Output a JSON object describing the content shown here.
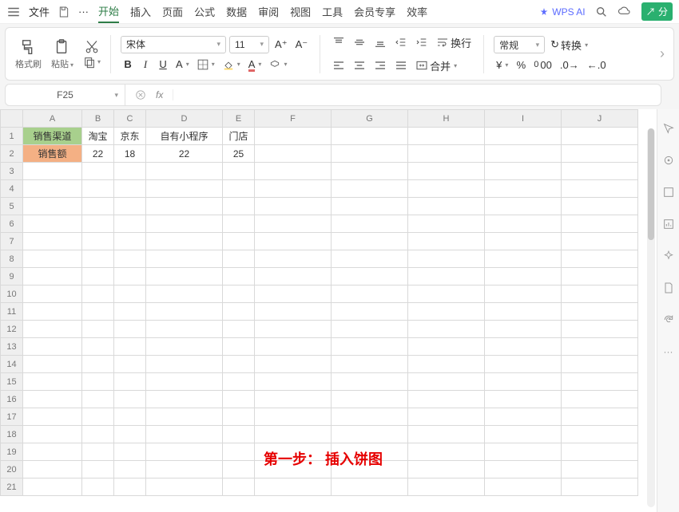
{
  "menubar": {
    "file": "文件",
    "tabs": [
      "开始",
      "插入",
      "页面",
      "公式",
      "数据",
      "审阅",
      "视图",
      "工具",
      "会员专享",
      "效率"
    ],
    "active_tab": 0,
    "ai_label": "WPS AI",
    "share": "分"
  },
  "ribbon": {
    "format_painter": "格式刷",
    "paste": "粘贴",
    "font_name": "宋体",
    "font_size": "11",
    "increase_font": "A⁺",
    "decrease_font": "A⁻",
    "bold": "B",
    "italic": "I",
    "underline": "U",
    "wrap": "换行",
    "merge": "合并",
    "number_format": "常规",
    "convert": "转换",
    "currency": "¥"
  },
  "namebox": "F25",
  "columns": [
    "A",
    "B",
    "C",
    "D",
    "E",
    "F",
    "G",
    "H",
    "I",
    "J"
  ],
  "selected_col": "F",
  "rows": 21,
  "table": {
    "r1": {
      "A": "销售渠道",
      "B": "淘宝",
      "C": "京东",
      "D": "自有小程序",
      "E": "门店"
    },
    "r2": {
      "A": "销售额",
      "B": "22",
      "C": "18",
      "D": "22",
      "E": "25"
    }
  },
  "overlay": "第一步： 插入饼图"
}
